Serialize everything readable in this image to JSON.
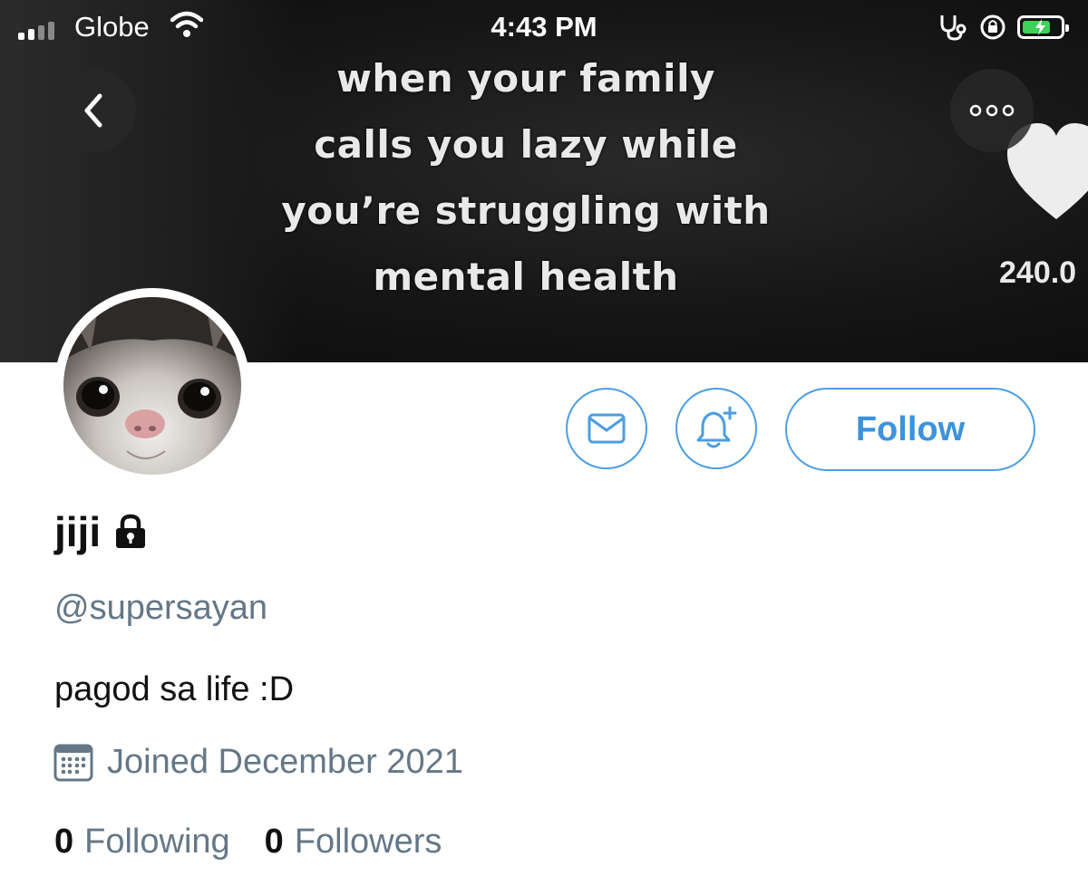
{
  "status_bar": {
    "carrier": "Globe",
    "time": "4:43 PM"
  },
  "banner": {
    "meme_lines": [
      "when your family",
      "calls you lazy while",
      "you’re struggling with",
      "mental health"
    ],
    "like_count": "240.0"
  },
  "profile": {
    "display_name": "jiji",
    "handle": "@supersayan",
    "bio": "pagod sa life :D",
    "joined": "Joined December 2021",
    "following_count": "0",
    "following_label": "Following",
    "followers_count": "0",
    "followers_label": "Followers",
    "locked": true
  },
  "actions": {
    "follow_label": "Follow"
  },
  "icons": {
    "back": "chevron-left-icon",
    "more": "more-icon",
    "message": "mail-icon",
    "notify": "bell-plus-icon",
    "lock": "lock-icon",
    "calendar": "calendar-icon"
  },
  "colors": {
    "accent": "#4b9ee3",
    "secondary_text": "#657786",
    "battery": "#3fd15a"
  }
}
